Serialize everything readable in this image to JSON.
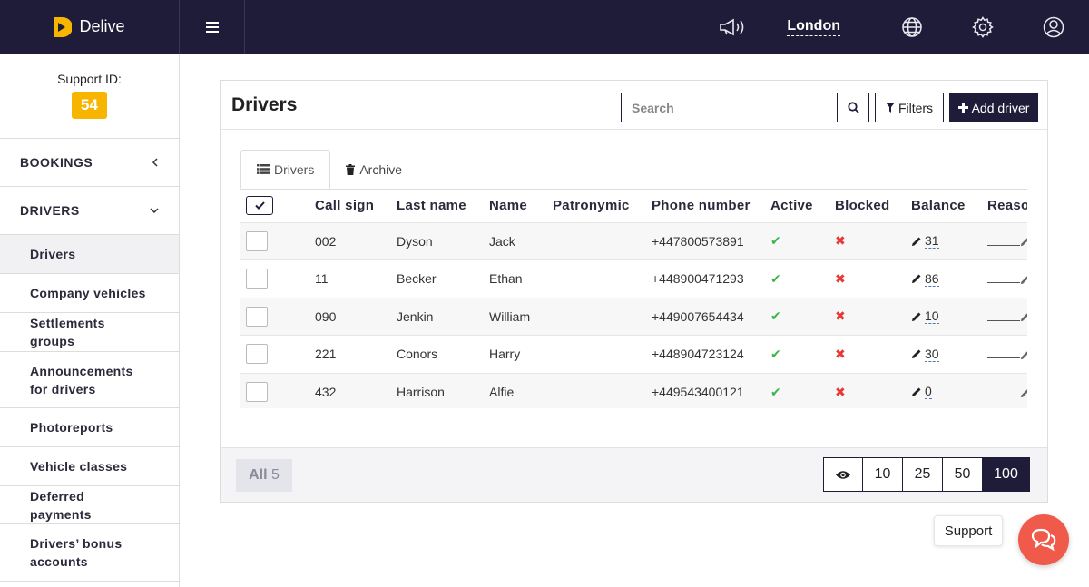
{
  "app": {
    "name": "Delive"
  },
  "header": {
    "city": "London"
  },
  "sidebar": {
    "support_label": "Support ID:",
    "support_id": "54",
    "sections": [
      {
        "label": "BOOKINGS",
        "expanded": false
      },
      {
        "label": "DRIVERS",
        "expanded": true
      }
    ],
    "items": [
      {
        "label": "Drivers",
        "active": true
      },
      {
        "label": "Company vehicles"
      },
      {
        "label": "Settlements groups"
      },
      {
        "label": "Announcements for drivers"
      },
      {
        "label": "Photoreports"
      },
      {
        "label": "Vehicle classes"
      },
      {
        "label": "Deferred payments"
      },
      {
        "label": "Drivers’ bonus accounts"
      }
    ]
  },
  "card": {
    "title": "Drivers",
    "search_placeholder": "Search",
    "filters_label": "Filters",
    "add_label": "Add driver",
    "tabs": [
      {
        "label": "Drivers",
        "active": true
      },
      {
        "label": "Archive"
      }
    ]
  },
  "table": {
    "columns": [
      "Call sign",
      "Last name",
      "Name",
      "Patronymic",
      "Phone number",
      "Active",
      "Blocked",
      "Balance",
      "Reaso"
    ],
    "rows": [
      {
        "call_sign": "002",
        "last_name": "Dyson",
        "name": "Jack",
        "patronymic": "",
        "phone": "+447800573891",
        "active": "✔",
        "blocked": "✖",
        "balance": "31"
      },
      {
        "call_sign": "11",
        "last_name": "Becker",
        "name": "Ethan",
        "patronymic": "",
        "phone": "+448900471293",
        "active": "✔",
        "blocked": "✖",
        "balance": "86"
      },
      {
        "call_sign": "090",
        "last_name": "Jenkin",
        "name": "William",
        "patronymic": "",
        "phone": "+449007654434",
        "active": "✔",
        "blocked": "✖",
        "balance": "10"
      },
      {
        "call_sign": "221",
        "last_name": "Conors",
        "name": "Harry",
        "patronymic": "",
        "phone": "+448904723124",
        "active": "✔",
        "blocked": "✖",
        "balance": "30"
      },
      {
        "call_sign": "432",
        "last_name": "Harrison",
        "name": "Alfie",
        "patronymic": "",
        "phone": "+449543400121",
        "active": "✔",
        "blocked": "✖",
        "balance": "0"
      }
    ]
  },
  "footer": {
    "all_label": "All",
    "all_count": "5",
    "page_sizes": [
      "10",
      "25",
      "50",
      "100"
    ],
    "selected_page_size": "100"
  },
  "support": {
    "label": "Support"
  },
  "colors": {
    "primary": "#1f1c3a",
    "badge": "#f7b500",
    "support": "#f05a4a",
    "ok": "#3bb54a",
    "no": "#e53935"
  }
}
